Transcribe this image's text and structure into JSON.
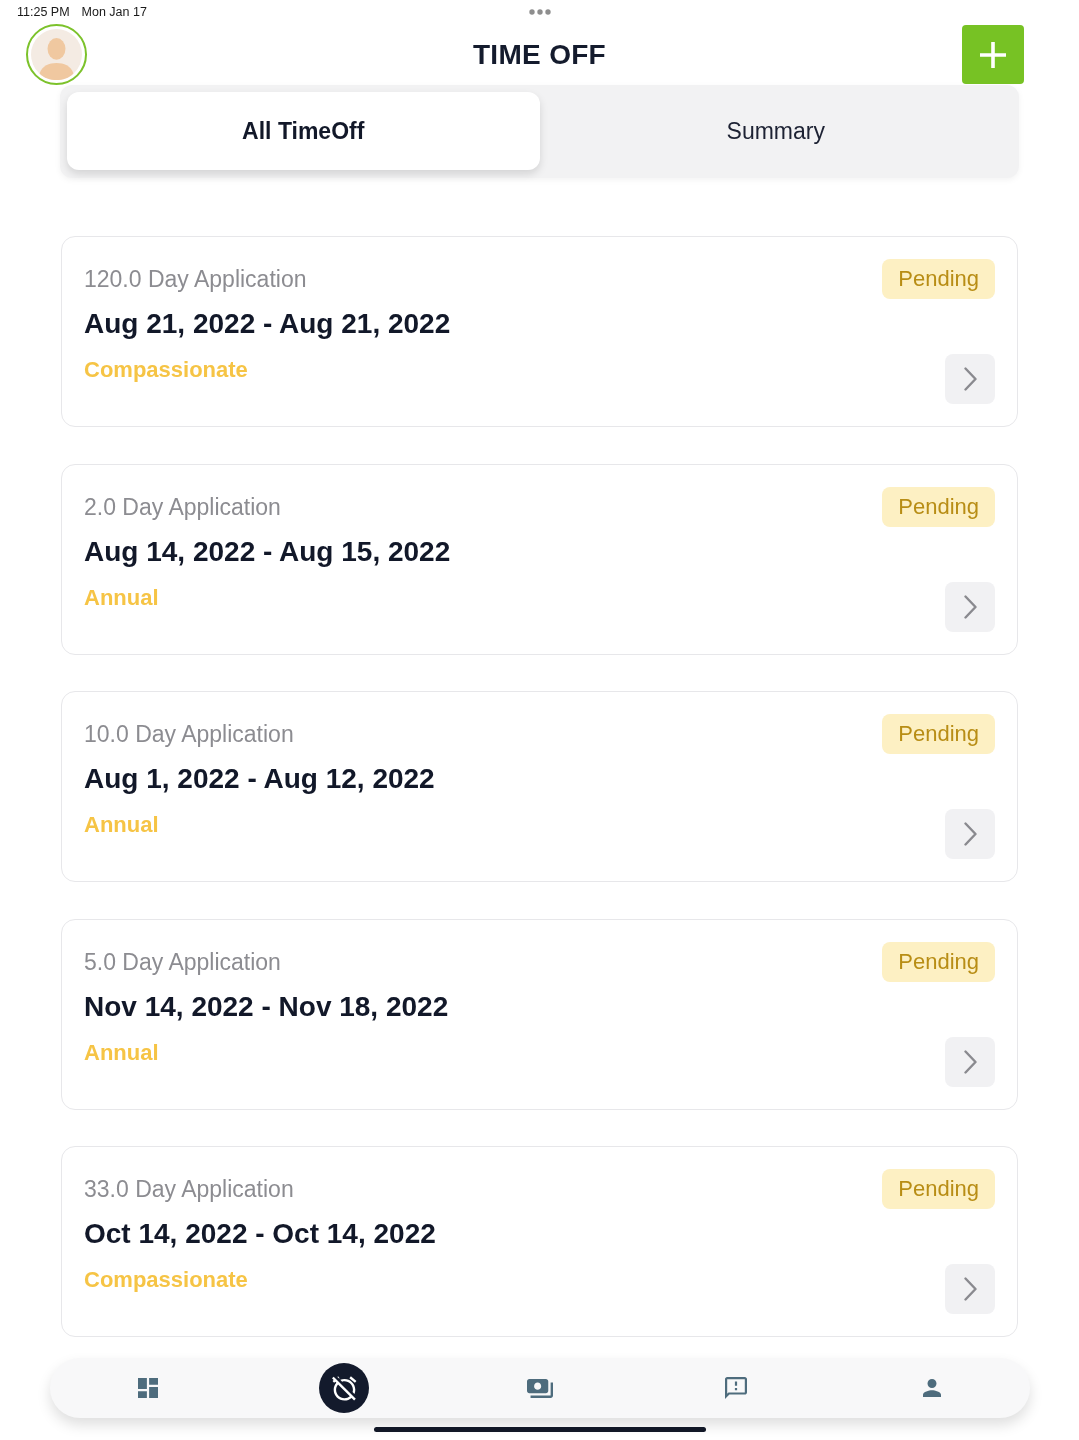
{
  "status_bar": {
    "time": "11:25 PM",
    "date": "Mon Jan 17"
  },
  "header": {
    "title": "TIME OFF"
  },
  "tabs": [
    {
      "label": "All TimeOff",
      "selected": true
    },
    {
      "label": "Summary",
      "selected": false
    }
  ],
  "applications": [
    {
      "duration": "120.0 Day Application",
      "dates": "Aug 21, 2022 - Aug 21, 2022",
      "type": "Compassionate",
      "status": "Pending"
    },
    {
      "duration": "2.0 Day Application",
      "dates": "Aug 14, 2022 - Aug 15, 2022",
      "type": "Annual",
      "status": "Pending"
    },
    {
      "duration": "10.0 Day Application",
      "dates": "Aug 1, 2022 - Aug 12, 2022",
      "type": "Annual",
      "status": "Pending"
    },
    {
      "duration": "5.0 Day Application",
      "dates": "Nov 14, 2022 - Nov 18, 2022",
      "type": "Annual",
      "status": "Pending"
    },
    {
      "duration": "33.0 Day Application",
      "dates": "Oct 14, 2022 - Oct 14, 2022",
      "type": "Compassionate",
      "status": "Pending"
    }
  ],
  "bottom_nav": [
    {
      "kind": "dashboard",
      "selected": false
    },
    {
      "kind": "alarm_off",
      "selected": true
    },
    {
      "kind": "payments",
      "selected": false
    },
    {
      "kind": "feedback",
      "selected": false
    },
    {
      "kind": "profile",
      "selected": false
    }
  ]
}
